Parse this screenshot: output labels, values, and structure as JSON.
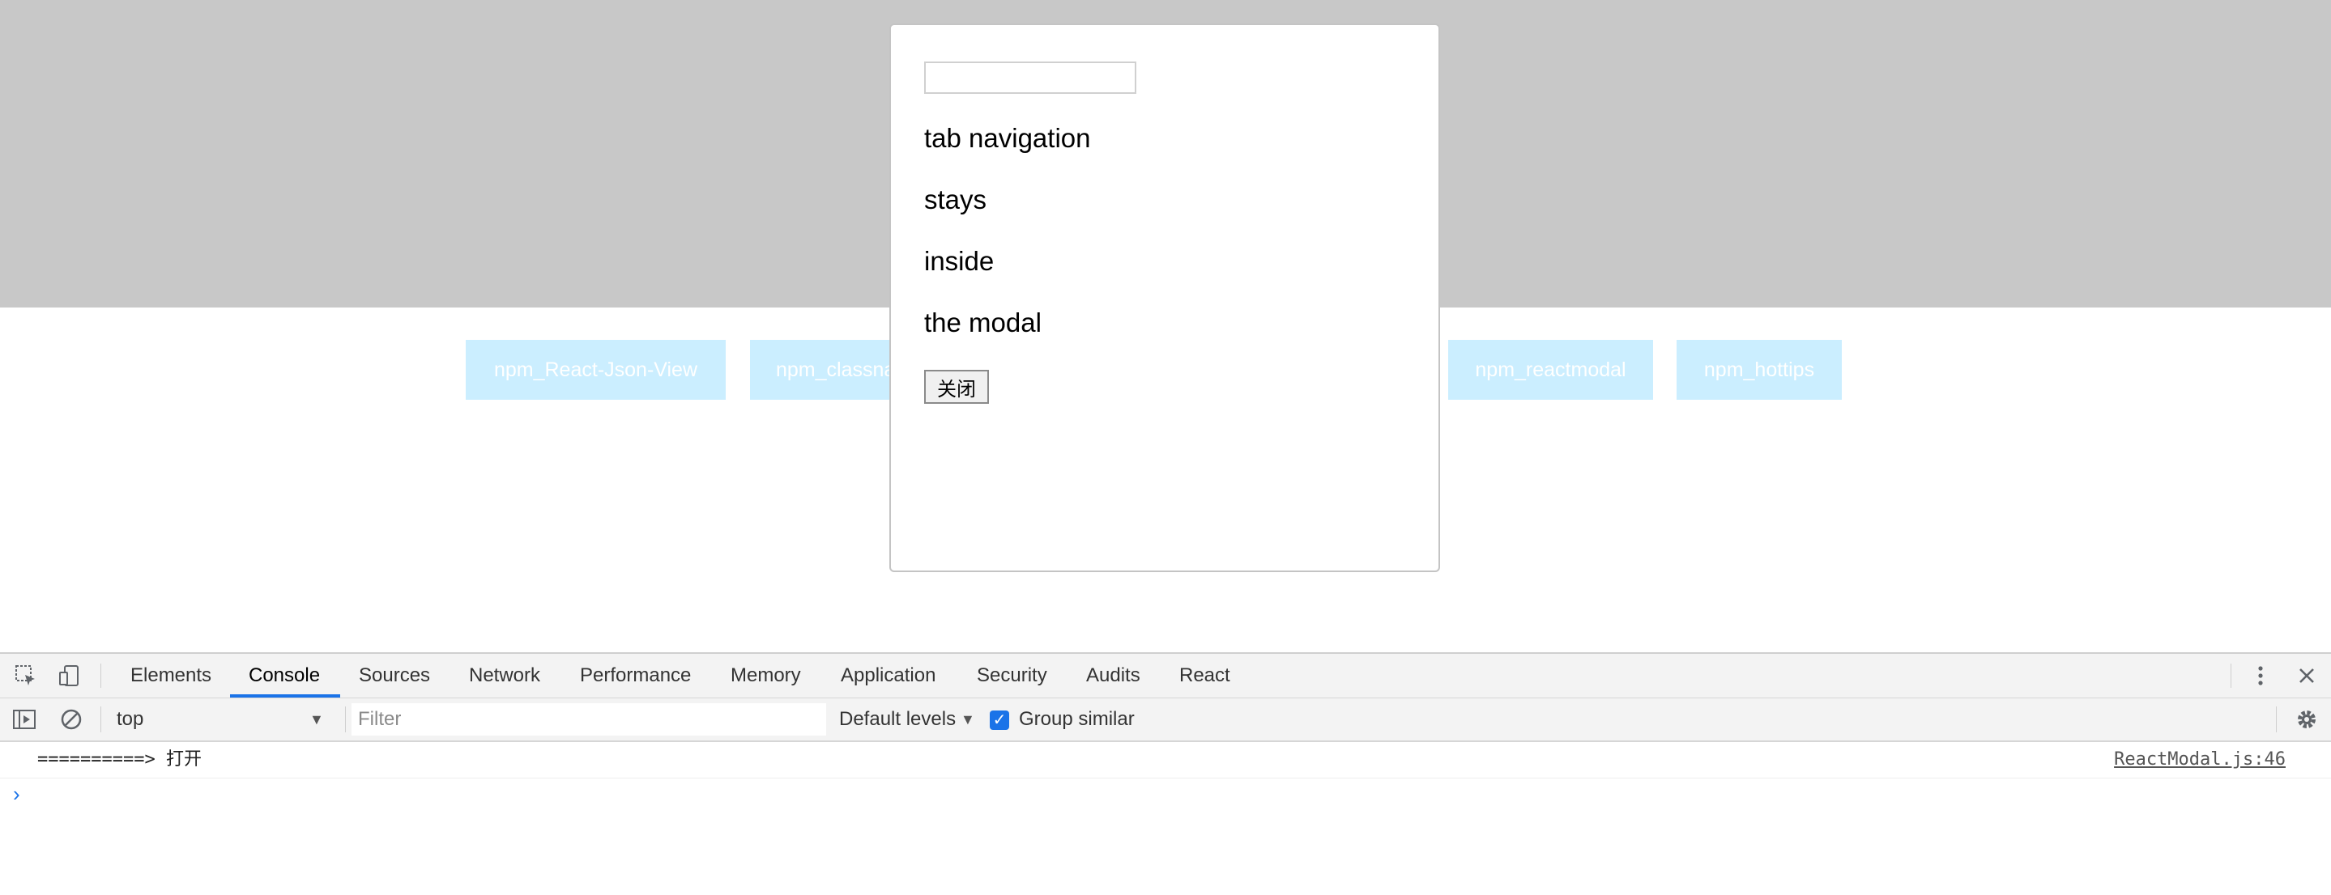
{
  "page": {
    "nav_buttons": [
      {
        "label": "npm_React-Json-View"
      },
      {
        "label": "npm_classna"
      },
      {
        "label": "npm_reactmodal"
      },
      {
        "label": "npm_hottips"
      }
    ]
  },
  "modal": {
    "input_value": "",
    "lines": [
      "tab navigation",
      "stays",
      "inside",
      "the modal"
    ],
    "close_label": "关闭"
  },
  "devtools": {
    "tabs": [
      "Elements",
      "Console",
      "Sources",
      "Network",
      "Performance",
      "Memory",
      "Application",
      "Security",
      "Audits",
      "React"
    ],
    "active_tab": "Console",
    "context": "top",
    "filter_placeholder": "Filter",
    "levels": "Default levels",
    "group_similar": {
      "label": "Group similar",
      "checked": true
    },
    "messages": [
      {
        "text": "==========> 打开",
        "source": "ReactModal.js:46"
      }
    ],
    "prompt": "›",
    "accent_color": "#1a73e8"
  },
  "colors": {
    "overlay": "#c8c8c8",
    "nav_button_bg": "#cbeeff"
  }
}
